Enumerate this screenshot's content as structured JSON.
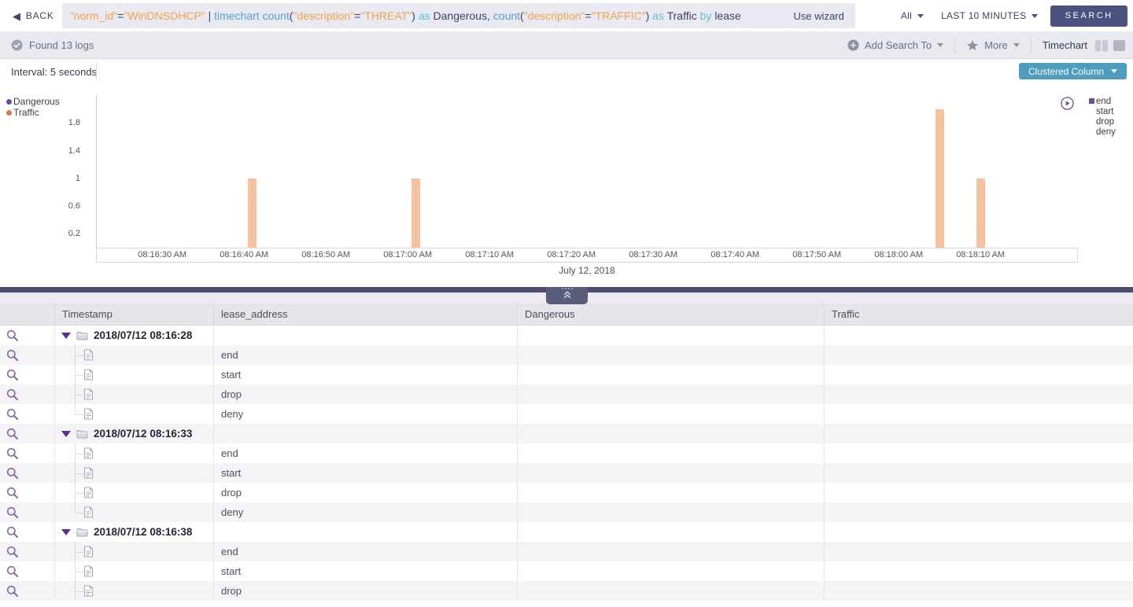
{
  "topbar": {
    "back_label": "BACK",
    "query_tokens": [
      {
        "t": "\"norm_id\"",
        "c": "str"
      },
      {
        "t": "=",
        "c": "plain"
      },
      {
        "t": "\"WinDNSDHCP\"",
        "c": "str"
      },
      {
        "t": " | ",
        "c": "plain"
      },
      {
        "t": "timechart ",
        "c": "kw"
      },
      {
        "t": "count",
        "c": "kw"
      },
      {
        "t": "(",
        "c": "plain"
      },
      {
        "t": "\"description\"",
        "c": "str"
      },
      {
        "t": "=",
        "c": "plain"
      },
      {
        "t": "\"THREAT\"",
        "c": "str"
      },
      {
        "t": ") ",
        "c": "plain"
      },
      {
        "t": "as ",
        "c": "mod"
      },
      {
        "t": "Dangerous, ",
        "c": "plain"
      },
      {
        "t": "count",
        "c": "kw"
      },
      {
        "t": "(",
        "c": "plain"
      },
      {
        "t": "\"description\"",
        "c": "str"
      },
      {
        "t": "=",
        "c": "plain"
      },
      {
        "t": "\"TRAFFIC\"",
        "c": "str"
      },
      {
        "t": ") ",
        "c": "plain"
      },
      {
        "t": "as ",
        "c": "mod"
      },
      {
        "t": "Traffic ",
        "c": "plain"
      },
      {
        "t": "by ",
        "c": "mod"
      },
      {
        "t": "lease",
        "c": "plain"
      }
    ],
    "use_wizard_label": "Use wizard",
    "scope_label": "All",
    "time_range_label": "LAST 10 MINUTES",
    "search_label": "SEARCH"
  },
  "toolbar": {
    "status_text": "Found 13 logs",
    "add_search_to_label": "Add Search To",
    "more_label": "More",
    "view_label": "Timechart"
  },
  "chart": {
    "interval_label": "Interval: 5 seconds",
    "chart_type_button_label": "Clustered Column"
  },
  "chart_data": {
    "type": "bar",
    "title": "Timechart",
    "interval": "5 seconds",
    "date_label": "July 12, 2018",
    "grid": false,
    "legend_position": "left",
    "x_axis": {
      "start": "08:16:22 AM",
      "span_seconds": 120,
      "tick_labels": [
        "08:16:30 AM",
        "08:16:40 AM",
        "08:16:50 AM",
        "08:17:00 AM",
        "08:17:10 AM",
        "08:17:20 AM",
        "08:17:30 AM",
        "08:17:40 AM",
        "08:17:50 AM",
        "08:18:00 AM",
        "08:18:10 AM"
      ]
    },
    "y_axis": {
      "ticks": [
        1.8,
        1.4,
        1,
        0.6,
        0.2
      ],
      "ylim": [
        0,
        2.2
      ]
    },
    "series": [
      {
        "name": "Dangerous",
        "color": "#6F4B9B",
        "bar_color": "#6F4B9B",
        "bars": []
      },
      {
        "name": "Traffic",
        "color": "#E8744D",
        "bar_color": "#F5C29F",
        "bars": [
          {
            "x": "08:16:41 AM",
            "y": 1
          },
          {
            "x": "08:17:01 AM",
            "y": 1
          },
          {
            "x": "08:18:05 AM",
            "y": 2
          },
          {
            "x": "08:18:10 AM",
            "y": 1
          }
        ]
      }
    ],
    "right_legend": [
      {
        "label": "end",
        "marker_color": "#6F4B9B"
      },
      {
        "label": "start",
        "marker_color": ""
      },
      {
        "label": "drop",
        "marker_color": ""
      },
      {
        "label": "deny",
        "marker_color": ""
      }
    ]
  },
  "table": {
    "columns": [
      "Timestamp",
      "lease_address",
      "Dangerous",
      "Traffic"
    ],
    "rows": [
      {
        "type": "group",
        "timestamp": "2018/07/12 08:16:28"
      },
      {
        "type": "child",
        "lease_address": "end"
      },
      {
        "type": "child",
        "lease_address": "start"
      },
      {
        "type": "child",
        "lease_address": "drop"
      },
      {
        "type": "child",
        "lease_address": "deny",
        "last": true
      },
      {
        "type": "group",
        "timestamp": "2018/07/12 08:16:33"
      },
      {
        "type": "child",
        "lease_address": "end"
      },
      {
        "type": "child",
        "lease_address": "start"
      },
      {
        "type": "child",
        "lease_address": "drop"
      },
      {
        "type": "child",
        "lease_address": "deny",
        "last": true
      },
      {
        "type": "group",
        "timestamp": "2018/07/12 08:16:38"
      },
      {
        "type": "child",
        "lease_address": "end"
      },
      {
        "type": "child",
        "lease_address": "start"
      },
      {
        "type": "child",
        "lease_address": "drop"
      }
    ]
  }
}
